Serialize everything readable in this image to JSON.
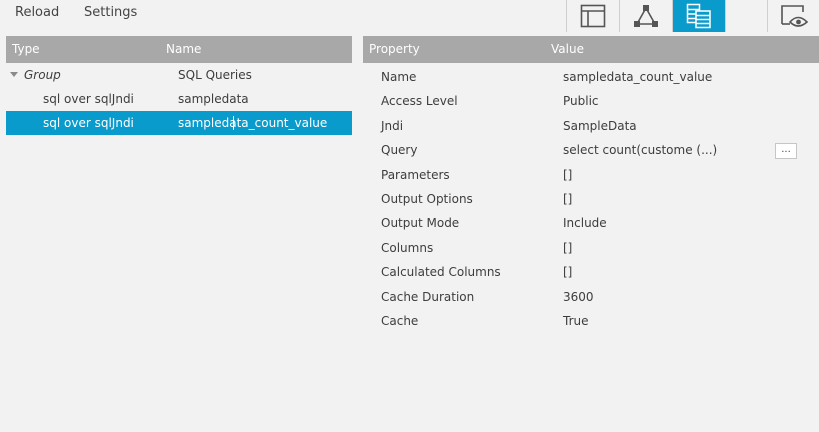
{
  "toolbar": {
    "reload_label": "Reload",
    "settings_label": "Settings"
  },
  "colors": {
    "accent": "#0a9bcd",
    "header_bg": "#a8a8a8",
    "panel_bg": "#f2f2f2"
  },
  "icons": [
    "layout-icon",
    "graph-icon",
    "query-table-icon",
    "preview-icon"
  ],
  "left_panel": {
    "headers": {
      "type": "Type",
      "name": "Name"
    },
    "group": {
      "type": "Group",
      "name": "SQL Queries"
    },
    "items": [
      {
        "type": "sql over sqlJndi",
        "name": "sampledata",
        "selected": false
      },
      {
        "type": "sql over sqlJndi",
        "name": "sampledata_count_value",
        "selected": true
      }
    ]
  },
  "right_panel": {
    "headers": {
      "property": "Property",
      "value": "Value"
    },
    "rows": [
      {
        "name": "Name",
        "value": "sampledata_count_value"
      },
      {
        "name": "Access Level",
        "value": "Public"
      },
      {
        "name": "Jndi",
        "value": "SampleData"
      },
      {
        "name": "Query",
        "value": "select count(custome (...)",
        "button": "..."
      },
      {
        "name": "Parameters",
        "value": "[]"
      },
      {
        "name": "Output Options",
        "value": "[]"
      },
      {
        "name": "Output Mode",
        "value": "Include"
      },
      {
        "name": "Columns",
        "value": "[]"
      },
      {
        "name": "Calculated Columns",
        "value": "[]"
      },
      {
        "name": "Cache Duration",
        "value": "3600"
      },
      {
        "name": "Cache",
        "value": "True"
      }
    ]
  }
}
